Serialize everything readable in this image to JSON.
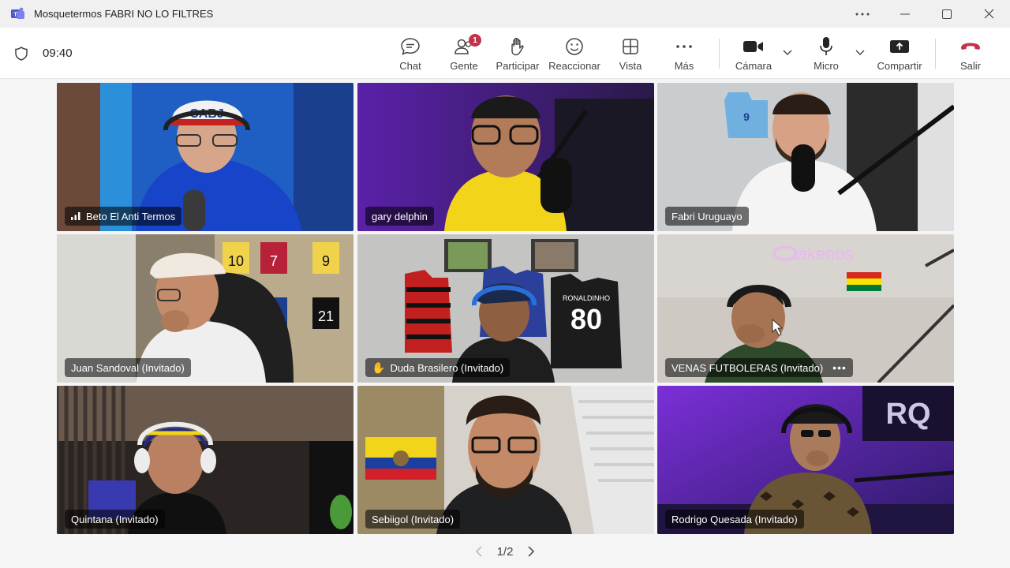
{
  "window": {
    "title": "Mosquetermos FABRI NO LO FILTRES"
  },
  "toolbar": {
    "timer": "09:40",
    "chat_label": "Chat",
    "people_label": "Gente",
    "people_badge": "1",
    "participate_label": "Participar",
    "react_label": "Reaccionar",
    "view_label": "Vista",
    "more_label": "Más",
    "camera_label": "Cámara",
    "mic_label": "Micro",
    "share_label": "Compartir",
    "leave_label": "Salir"
  },
  "colors": {
    "speaking_border": "#7b83eb",
    "raised_hand_border": "#f0b429",
    "leave_red": "#c4314b",
    "badge_red": "#c4314b"
  },
  "participants": [
    {
      "name": "Beto El Anti Termos",
      "state": "signal"
    },
    {
      "name": "gary delphin",
      "state": "speaking"
    },
    {
      "name": "Fabri Uruguayo",
      "state": "speaking"
    },
    {
      "name": "Juan Sandoval (Invitado)",
      "state": "normal"
    },
    {
      "name": "Duda Brasilero (Invitado)",
      "state": "hand-raised"
    },
    {
      "name": "VENAS FUTBOLERAS (Invitado)",
      "state": "more-options"
    },
    {
      "name": "Quintana (Invitado)",
      "state": "normal"
    },
    {
      "name": "Sebiigol (Invitado)",
      "state": "normal"
    },
    {
      "name": "Rodrigo Quesada (Invitado)",
      "state": "normal"
    }
  ],
  "video_labels": {
    "shirt_number": "80",
    "shirt_name": "RONALDINHO",
    "cap_text": "CABJ",
    "neon_sign": "takenos",
    "wall_letters": "RQ"
  },
  "pager": {
    "label": "1/2"
  }
}
